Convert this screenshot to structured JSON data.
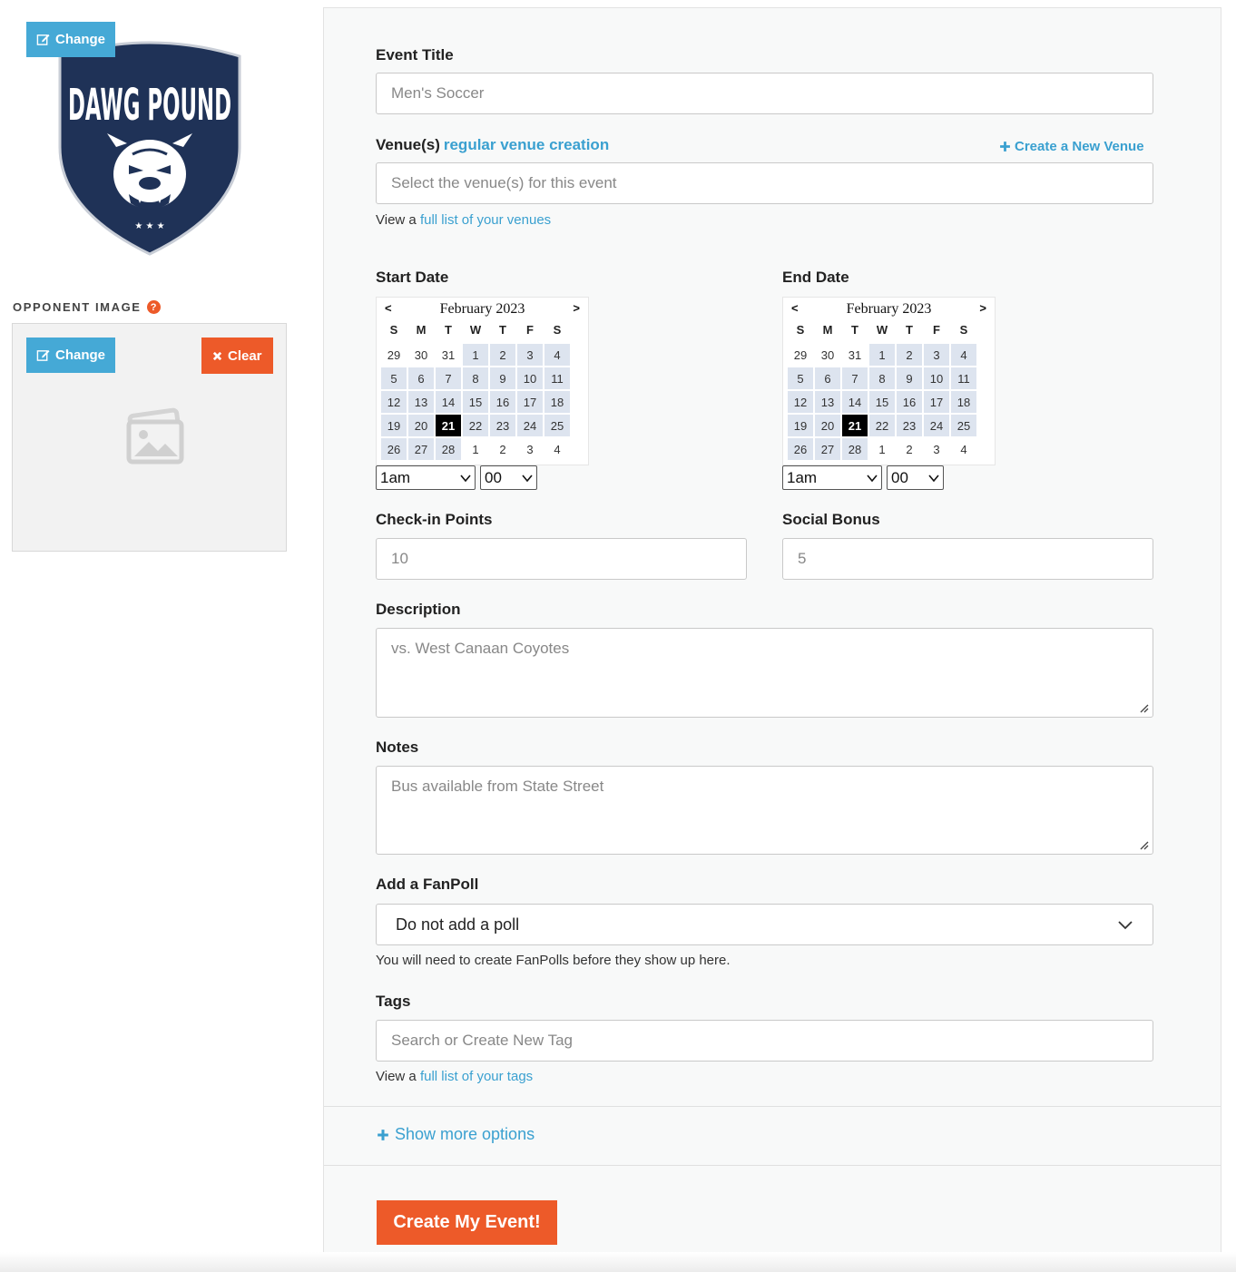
{
  "logo": {
    "change_label": "Change",
    "line1": "DAWG",
    "line2": "POUND",
    "colors": {
      "navy": "#1f3257",
      "white": "#ffffff"
    }
  },
  "opponent": {
    "label": "OPPONENT IMAGE",
    "help_glyph": "?",
    "change_label": "Change",
    "clear_label": "Clear"
  },
  "form": {
    "event_title": {
      "label": "Event Title",
      "placeholder": "Men's Soccer"
    },
    "venue": {
      "label": "Venue(s)",
      "link_label": "regular venue creation",
      "create_label": "Create a New Venue",
      "placeholder": "Select the venue(s) for this event",
      "help_prefix": "View a",
      "help_link": "full list of your venues"
    },
    "start_date": {
      "label": "Start Date",
      "hour": "1am",
      "minute": "00"
    },
    "end_date": {
      "label": "End Date",
      "hour": "1am",
      "minute": "00"
    },
    "calendar": {
      "month": "February 2023",
      "prev": "<",
      "next": ">",
      "dow": [
        "S",
        "M",
        "T",
        "W",
        "T",
        "F",
        "S"
      ],
      "days": [
        {
          "d": "29",
          "cur": false
        },
        {
          "d": "30",
          "cur": false
        },
        {
          "d": "31",
          "cur": false
        },
        {
          "d": "1",
          "cur": true
        },
        {
          "d": "2",
          "cur": true
        },
        {
          "d": "3",
          "cur": true
        },
        {
          "d": "4",
          "cur": true
        },
        {
          "d": "5",
          "cur": true
        },
        {
          "d": "6",
          "cur": true
        },
        {
          "d": "7",
          "cur": true
        },
        {
          "d": "8",
          "cur": true
        },
        {
          "d": "9",
          "cur": true
        },
        {
          "d": "10",
          "cur": true
        },
        {
          "d": "11",
          "cur": true
        },
        {
          "d": "12",
          "cur": true
        },
        {
          "d": "13",
          "cur": true
        },
        {
          "d": "14",
          "cur": true
        },
        {
          "d": "15",
          "cur": true
        },
        {
          "d": "16",
          "cur": true
        },
        {
          "d": "17",
          "cur": true
        },
        {
          "d": "18",
          "cur": true
        },
        {
          "d": "19",
          "cur": true
        },
        {
          "d": "20",
          "cur": true
        },
        {
          "d": "21",
          "cur": true,
          "sel": true
        },
        {
          "d": "22",
          "cur": true
        },
        {
          "d": "23",
          "cur": true
        },
        {
          "d": "24",
          "cur": true
        },
        {
          "d": "25",
          "cur": true
        },
        {
          "d": "26",
          "cur": true
        },
        {
          "d": "27",
          "cur": true
        },
        {
          "d": "28",
          "cur": true
        },
        {
          "d": "1",
          "cur": false
        },
        {
          "d": "2",
          "cur": false
        },
        {
          "d": "3",
          "cur": false
        },
        {
          "d": "4",
          "cur": false
        }
      ]
    },
    "checkin": {
      "label": "Check-in Points",
      "placeholder": "10"
    },
    "social": {
      "label": "Social Bonus",
      "placeholder": "5"
    },
    "description": {
      "label": "Description",
      "placeholder": "vs. West Canaan Coyotes"
    },
    "notes": {
      "label": "Notes",
      "placeholder": "Bus available from State Street"
    },
    "fanpoll": {
      "label": "Add a FanPoll",
      "selected": "Do not add a poll",
      "help": "You will need to create FanPolls before they show up here."
    },
    "tags": {
      "label": "Tags",
      "placeholder": "Search or Create New Tag",
      "help_prefix": "View a",
      "help_link": "full list of your tags"
    },
    "more_options": "Show more options",
    "submit": "Create My Event!"
  },
  "colors": {
    "accent_blue": "#45a9d6",
    "accent_orange": "#ed5a29",
    "selected_day": "#000000",
    "month_day": "#dde4ef"
  }
}
